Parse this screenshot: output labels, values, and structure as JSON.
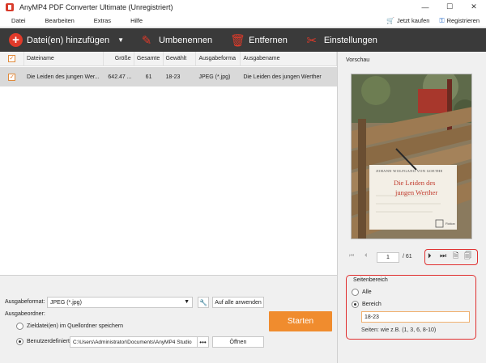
{
  "window": {
    "title": "AnyMP4 PDF Converter Ultimate (Unregistriert)",
    "controls": [
      "—",
      "☐",
      "✕"
    ]
  },
  "menu": {
    "items": [
      "Datei",
      "Bearbeiten",
      "Extras",
      "Hilfe"
    ],
    "buy": "Jetzt kaufen",
    "register": "Registrieren"
  },
  "toolbar": {
    "add": "Datei(en) hinzufügen",
    "rename": "Umbenennen",
    "delete": "Entfernen",
    "settings": "Einstellungen"
  },
  "filelist": {
    "columns": [
      "Dateiname",
      "Größe",
      "Gesamte",
      "Gewählt",
      "Ausgabeforma",
      "Ausgabename"
    ],
    "rows": [
      {
        "name": "Die Leiden des jungen Wer...",
        "size": "642.47 ...",
        "total": "61",
        "selected": "18-23",
        "format": "JPEG (*.jpg)",
        "output": "Die Leiden des jungen Werther"
      }
    ]
  },
  "output": {
    "format_label": "Ausgabeformat:",
    "format_value": "JPEG (*.jpg)",
    "apply_all": "Auf alle anwenden",
    "folder_label": "Ausgabeordner:",
    "option_source": "Zieldatei(en) im Quellordner speichern",
    "option_custom": "Benutzerdefiniert:",
    "path": "C:\\Users\\Administrator\\Documents\\AnyMP4 Studio",
    "browse": "•••",
    "open": "Öffnen",
    "start": "Starten"
  },
  "preview": {
    "label": "Vorschau",
    "cover": {
      "author": "JOHANN WOLFGANG VON GOETHE",
      "title_line1": "Die Leiden des",
      "title_line2": "jungen Werther",
      "publisher": "Fiction"
    },
    "page": "1",
    "page_total": "/ 61"
  },
  "range": {
    "title": "Seitenbereich",
    "all": "Alle",
    "range": "Bereich",
    "value": "18-23",
    "hint": "Seiten: wie z.B. (1, 3, 6, 8-10)"
  },
  "colors": {
    "accent_orange": "#f08c2e",
    "toolbar_bg": "#3a3a3a",
    "icon_red": "#e03a2a",
    "highlight_red": "#e03030"
  }
}
